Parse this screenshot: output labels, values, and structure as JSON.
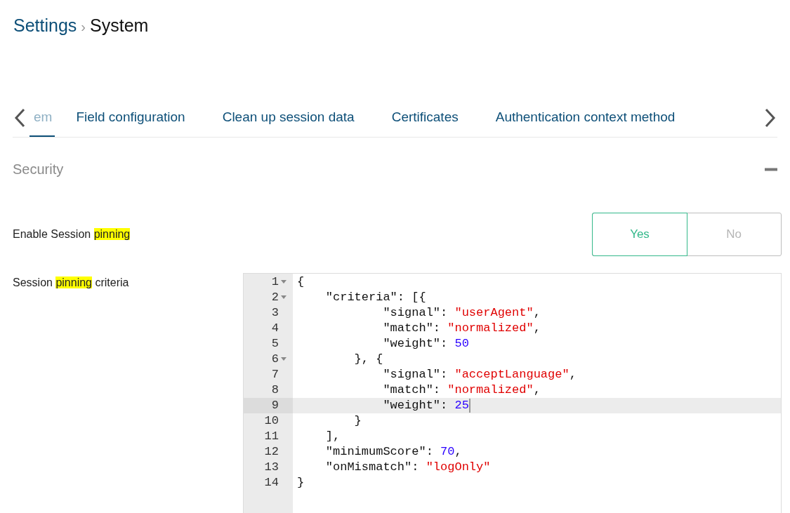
{
  "breadcrumb": {
    "parent": "Settings",
    "separator": "›",
    "current": "System"
  },
  "tabs": [
    {
      "label": "em",
      "selected": true
    },
    {
      "label": "Field configuration",
      "selected": false
    },
    {
      "label": "Clean up session data",
      "selected": false
    },
    {
      "label": "Certificates",
      "selected": false
    },
    {
      "label": "Authentication context method",
      "selected": false
    }
  ],
  "section": {
    "title": "Security",
    "expanded": true
  },
  "fields": [
    {
      "kind": "toggle",
      "label": [
        {
          "text": "Enable Session ",
          "highlight": false
        },
        {
          "text": "pinning",
          "highlight": true
        }
      ],
      "options": [
        {
          "label": "Yes",
          "selected": true
        },
        {
          "label": "No",
          "selected": false
        }
      ]
    },
    {
      "kind": "code",
      "label": [
        {
          "text": "Session ",
          "highlight": false
        },
        {
          "text": "pinning",
          "highlight": true
        },
        {
          "text": " criteria",
          "highlight": false
        }
      ],
      "lines": [
        {
          "number": "1",
          "fold": true,
          "selected": false,
          "tokens": [
            {
              "text": "{",
              "kind": "punct"
            }
          ]
        },
        {
          "number": "2",
          "fold": true,
          "selected": false,
          "tokens": [
            {
              "text": "    \"criteria\": [{",
              "kind": "punct"
            }
          ]
        },
        {
          "number": "3",
          "fold": false,
          "selected": false,
          "tokens": [
            {
              "text": "            \"signal\": ",
              "kind": "punct"
            },
            {
              "text": "\"userAgent\"",
              "kind": "string"
            },
            {
              "text": ",",
              "kind": "punct"
            }
          ]
        },
        {
          "number": "4",
          "fold": false,
          "selected": false,
          "tokens": [
            {
              "text": "            \"match\": ",
              "kind": "punct"
            },
            {
              "text": "\"normalized\"",
              "kind": "string"
            },
            {
              "text": ",",
              "kind": "punct"
            }
          ]
        },
        {
          "number": "5",
          "fold": false,
          "selected": false,
          "tokens": [
            {
              "text": "            \"weight\": ",
              "kind": "punct"
            },
            {
              "text": "50",
              "kind": "number"
            }
          ]
        },
        {
          "number": "6",
          "fold": true,
          "selected": false,
          "tokens": [
            {
              "text": "        }, {",
              "kind": "punct"
            }
          ]
        },
        {
          "number": "7",
          "fold": false,
          "selected": false,
          "tokens": [
            {
              "text": "            \"signal\": ",
              "kind": "punct"
            },
            {
              "text": "\"acceptLanguage\"",
              "kind": "string"
            },
            {
              "text": ",",
              "kind": "punct"
            }
          ]
        },
        {
          "number": "8",
          "fold": false,
          "selected": false,
          "tokens": [
            {
              "text": "            \"match\": ",
              "kind": "punct"
            },
            {
              "text": "\"normalized\"",
              "kind": "string"
            },
            {
              "text": ",",
              "kind": "punct"
            }
          ]
        },
        {
          "number": "9",
          "fold": false,
          "selected": true,
          "tokens": [
            {
              "text": "            \"weight\": ",
              "kind": "punct"
            },
            {
              "text": "25",
              "kind": "number"
            }
          ]
        },
        {
          "number": "10",
          "fold": false,
          "selected": false,
          "tokens": [
            {
              "text": "        }",
              "kind": "punct"
            }
          ]
        },
        {
          "number": "11",
          "fold": false,
          "selected": false,
          "tokens": [
            {
              "text": "    ],",
              "kind": "punct"
            }
          ]
        },
        {
          "number": "12",
          "fold": false,
          "selected": false,
          "tokens": [
            {
              "text": "    \"minimumScore\": ",
              "kind": "punct"
            },
            {
              "text": "70",
              "kind": "number"
            },
            {
              "text": ",",
              "kind": "punct"
            }
          ]
        },
        {
          "number": "13",
          "fold": false,
          "selected": false,
          "tokens": [
            {
              "text": "    \"onMismatch\": ",
              "kind": "punct"
            },
            {
              "text": "\"logOnly\"",
              "kind": "string"
            }
          ]
        },
        {
          "number": "14",
          "fold": false,
          "selected": false,
          "tokens": [
            {
              "text": "}",
              "kind": "punct"
            }
          ]
        }
      ]
    }
  ]
}
